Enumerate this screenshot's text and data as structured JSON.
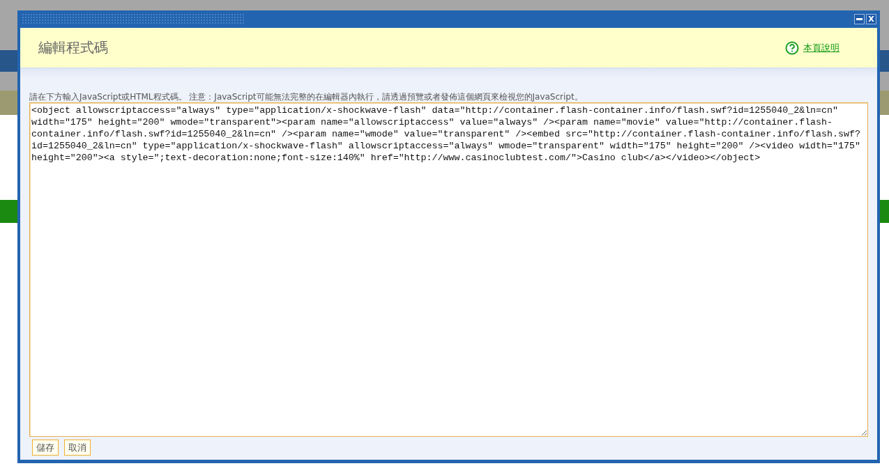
{
  "dialog": {
    "title_bar": {
      "close_label": "X"
    },
    "heading": "編輯程式碼",
    "help_link": "本頁說明",
    "instructions": "請在下方輸入JavaScript或HTML程式碼。 注意：JavaScript可能無法完整的在編輯器內執行，請透過預覽或者發佈這個網頁來檢視您的JavaScript。",
    "code": "<object allowscriptaccess=\"always\" type=\"application/x-shockwave-flash\" data=\"http://container.flash-container.info/flash.swf?id=1255040_2&ln=cn\" width=\"175\" height=\"200\" wmode=\"transparent\"><param name=\"allowscriptaccess\" value=\"always\" /><param name=\"movie\" value=\"http://container.flash-container.info/flash.swf?id=1255040_2&ln=cn\" /><param name=\"wmode\" value=\"transparent\" /><embed src=\"http://container.flash-container.info/flash.swf?id=1255040_2&ln=cn\" type=\"application/x-shockwave-flash\" allowscriptaccess=\"always\" wmode=\"transparent\" width=\"175\" height=\"200\" /><video width=\"175\" height=\"200\"><a style=\";text-decoration:none;font-size:140%\" href=\"http://www.casinoclubtest.com/\">Casino club</a></video></object>",
    "buttons": [
      "儲存",
      "取消"
    ]
  }
}
